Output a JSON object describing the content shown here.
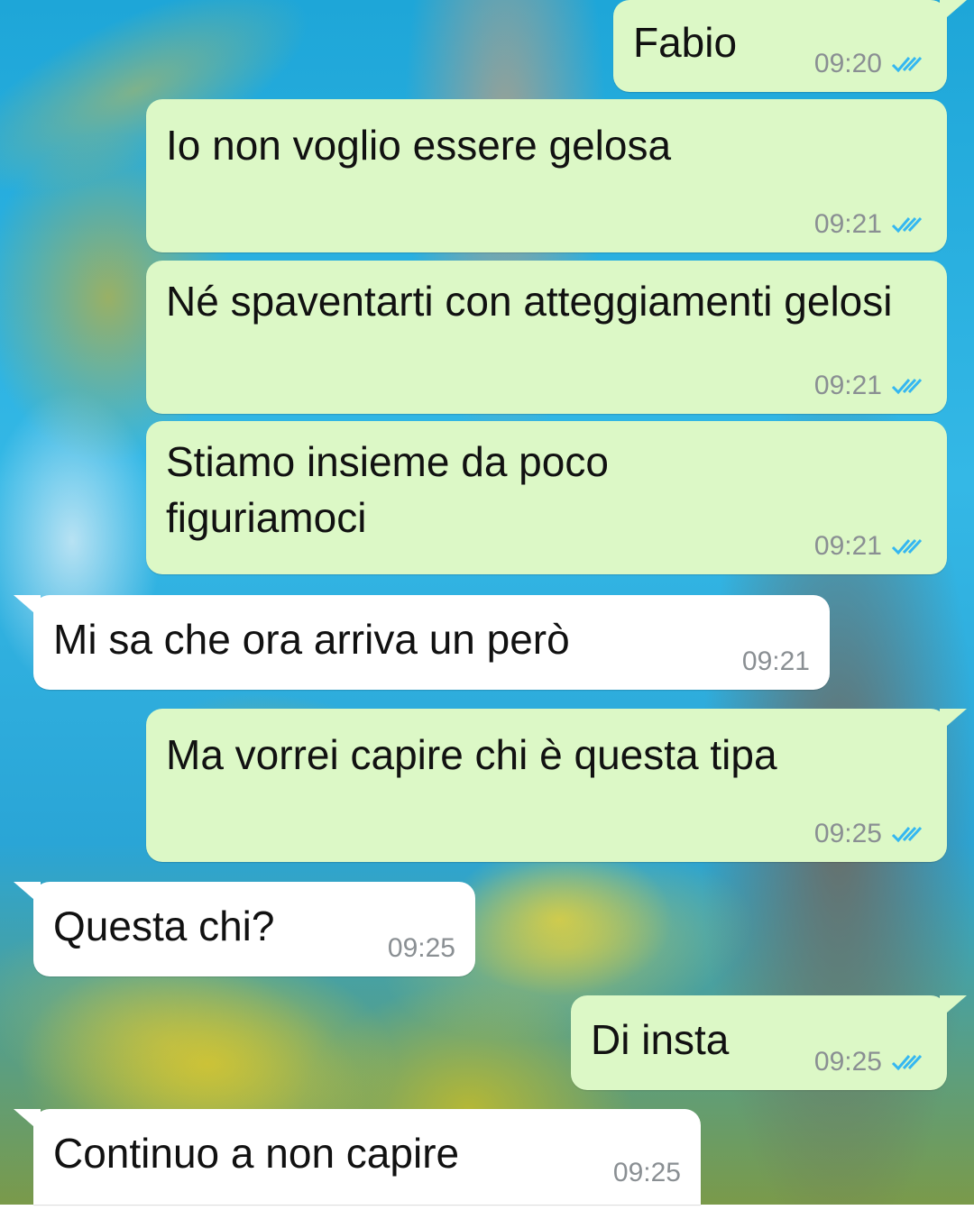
{
  "theme": {
    "outgoing_bubble": "#dcf8c6",
    "incoming_bubble": "#ffffff",
    "read_tick_color": "#34b7f1",
    "timestamp_color": "#8a8f93"
  },
  "messages": [
    {
      "direction": "outgoing",
      "text": "Fabio",
      "time": "09:20",
      "status": "read",
      "status_icon": "double-check-icon"
    },
    {
      "direction": "outgoing",
      "text": "Io non voglio essere gelosa",
      "time": "09:21",
      "status": "read",
      "status_icon": "double-check-icon"
    },
    {
      "direction": "outgoing",
      "text": "Né spaventarti con atteggiamenti gelosi",
      "time": "09:21",
      "status": "read",
      "status_icon": "double-check-icon"
    },
    {
      "direction": "outgoing",
      "text": "Stiamo insieme da poco figuriamoci",
      "time": "09:21",
      "status": "read",
      "status_icon": "double-check-icon"
    },
    {
      "direction": "incoming",
      "text": "Mi sa che ora arriva un però",
      "time": "09:21"
    },
    {
      "direction": "outgoing",
      "text": "Ma vorrei capire chi è questa tipa",
      "time": "09:25",
      "status": "read",
      "status_icon": "double-check-icon"
    },
    {
      "direction": "incoming",
      "text": "Questa chi?",
      "time": "09:25"
    },
    {
      "direction": "outgoing",
      "text": "Di insta",
      "time": "09:25",
      "status": "read",
      "status_icon": "double-check-icon"
    },
    {
      "direction": "incoming",
      "text": "Continuo a non capire",
      "time": "09:25"
    }
  ]
}
